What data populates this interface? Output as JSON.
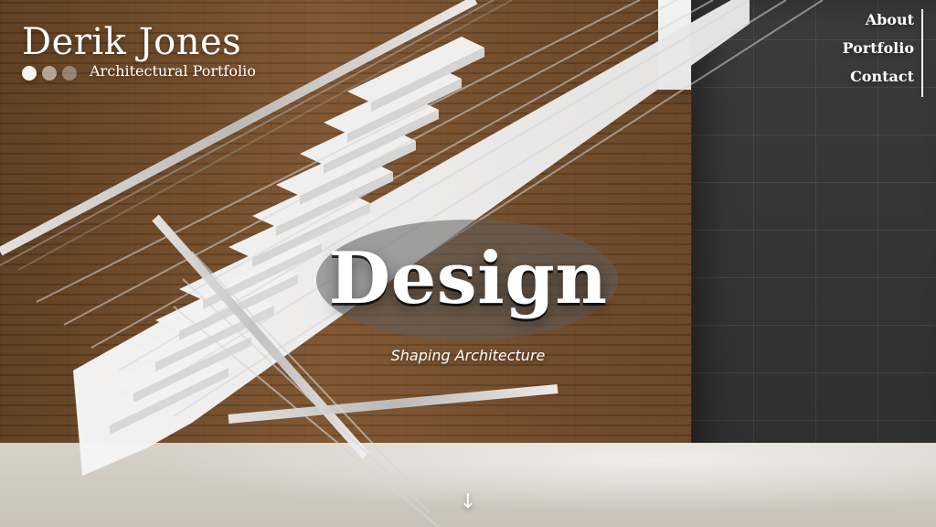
{
  "brand": {
    "title": "Derik Jones",
    "subtitle": "Architectural Portfolio"
  },
  "nav": {
    "items": [
      {
        "label": "About"
      },
      {
        "label": "Portfolio"
      },
      {
        "label": "Contact"
      }
    ]
  },
  "hero": {
    "title": "Design",
    "subtitle": "Shaping Architecture"
  },
  "scroll": {
    "icon": "arrow-down-icon",
    "glyph": "↓"
  },
  "colors": {
    "text": "#ffffff"
  }
}
